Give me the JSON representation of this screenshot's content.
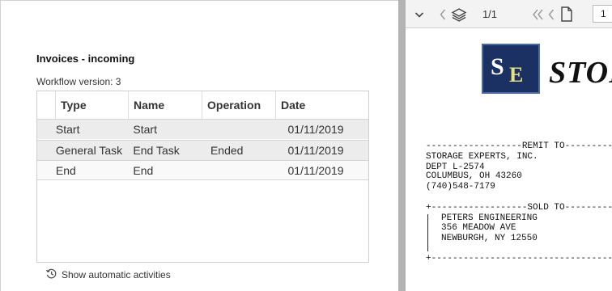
{
  "workflow": {
    "title": "Invoices - incoming",
    "version_label": "Workflow version: 3"
  },
  "grid": {
    "columns": [
      "Type",
      "Name",
      "Operation",
      "Date"
    ],
    "rows": [
      {
        "type": "Start",
        "name": "Start",
        "operation": "",
        "date": "01/11/2019"
      },
      {
        "type": "General Task",
        "name": "End Task",
        "operation": "Ended",
        "date": "01/11/2019"
      },
      {
        "type": "End",
        "name": "End",
        "operation": "",
        "date": "01/11/2019"
      }
    ]
  },
  "footer": {
    "auto_activities_label": "Show automatic activities",
    "icon": "history-icon"
  },
  "viewer": {
    "toolbar": {
      "chevron_icon": "chevron-down-icon",
      "prev_icon": "chevron-left-icon",
      "layers_icon": "layers-icon",
      "page_indicator": "1/1",
      "first_icon": "double-chevron-left-icon",
      "back_icon": "chevron-left-icon",
      "page_icon": "document-icon",
      "page_value": "1"
    },
    "document": {
      "logo_letters_s": "S",
      "logo_letters_e": "E",
      "logo_word": "STOR",
      "remit_header": "------------------REMIT TO---------------",
      "remit_lines": [
        "STORAGE EXPERTS, INC.",
        "DEPT L-2574",
        "COLUMBUS, OH 43260",
        "(740)548-7179"
      ],
      "sold_header": "+------------------SOLD TO---------------",
      "sold_lines": [
        "PETERS ENGINEERING",
        "356 MEADOW AVE",
        "NEWBURGH, NY 12550"
      ],
      "sold_footer": "+----------------------------------------"
    }
  },
  "colors": {
    "row_selected": "#ececec",
    "splitter": "#b3b3b3",
    "logo_bg": "#1c3163",
    "logo_accent": "#e8e37a"
  }
}
